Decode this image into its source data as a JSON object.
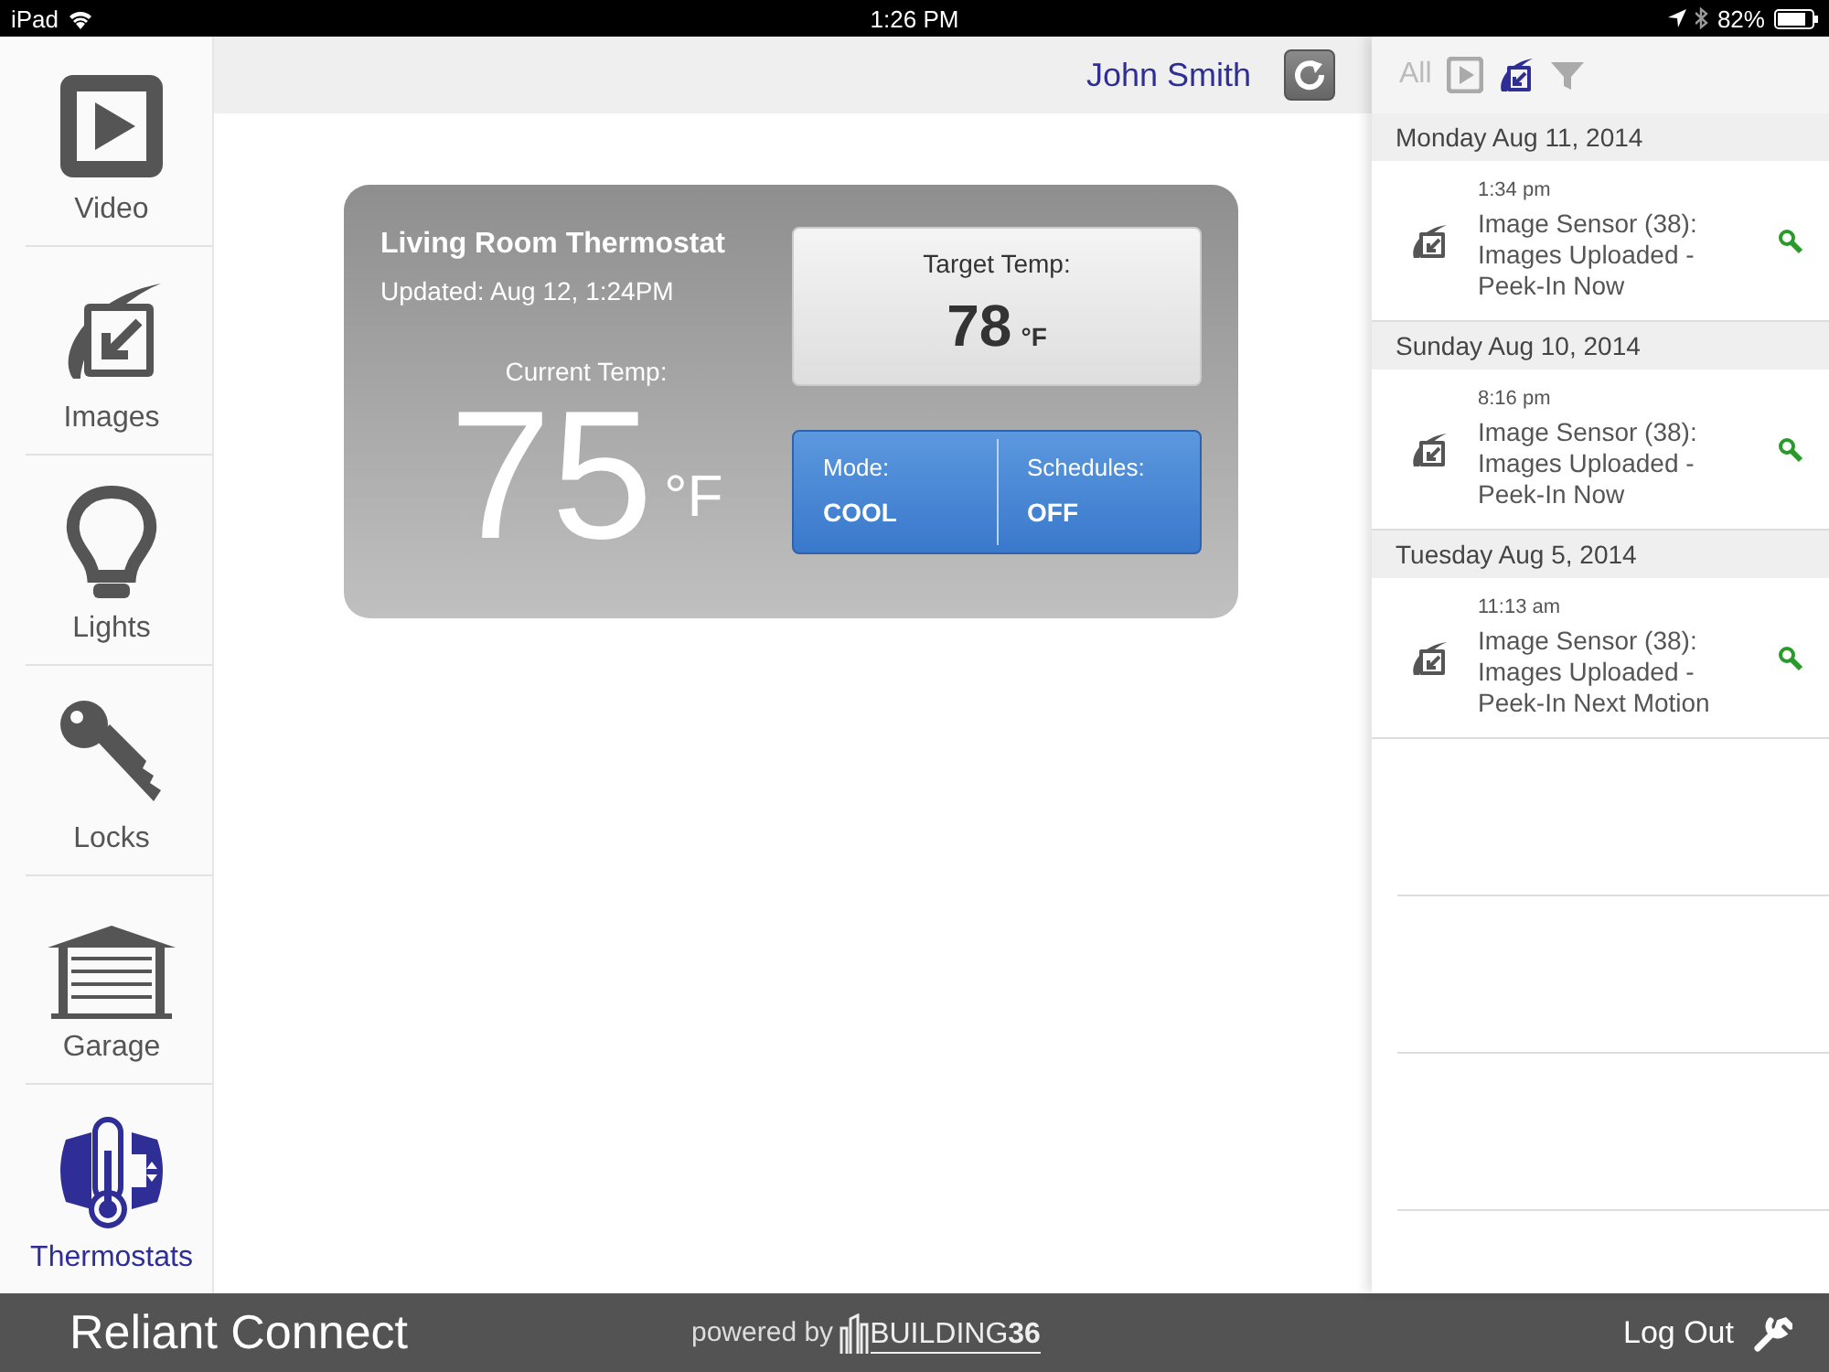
{
  "status_bar": {
    "device": "iPad",
    "time": "1:26 PM",
    "battery": "82%"
  },
  "sidebar": {
    "items": [
      {
        "kind": "video",
        "label": "Video",
        "selected": false
      },
      {
        "kind": "images",
        "label": "Images",
        "selected": false
      },
      {
        "kind": "lights",
        "label": "Lights",
        "selected": false
      },
      {
        "kind": "locks",
        "label": "Locks",
        "selected": false
      },
      {
        "kind": "garage",
        "label": "Garage",
        "selected": false
      },
      {
        "kind": "thermostats",
        "label": "Thermostats",
        "selected": true
      }
    ]
  },
  "header": {
    "user": "John Smith"
  },
  "thermostat": {
    "name": "Living Room Thermostat",
    "updated": "Updated: Aug 12, 1:24PM",
    "current_label": "Current Temp:",
    "current": "75",
    "current_unit": "°F",
    "target_label": "Target Temp:",
    "target": "78",
    "target_unit": "°F",
    "mode_label": "Mode:",
    "mode": "COOL",
    "schedules_label": "Schedules:",
    "schedules": "OFF"
  },
  "events": {
    "filters": [
      {
        "kind": "all",
        "label": "All",
        "selected": false
      },
      {
        "kind": "video",
        "selected": false
      },
      {
        "kind": "images",
        "selected": true
      },
      {
        "kind": "funnel",
        "selected": false
      }
    ],
    "days": [
      {
        "date": "Monday Aug 11, 2014",
        "items": [
          {
            "time": "1:34 pm",
            "text": "Image Sensor (38): Images Uploaded - Peek-In Now"
          }
        ]
      },
      {
        "date": "Sunday Aug 10, 2014",
        "items": [
          {
            "time": "8:16 pm",
            "text": "Image Sensor (38): Images Uploaded - Peek-In Now"
          }
        ]
      },
      {
        "date": "Tuesday Aug 5, 2014",
        "items": [
          {
            "time": "11:13 am",
            "text": "Image Sensor (38): Images Uploaded - Peek-In Next Motion"
          }
        ]
      }
    ]
  },
  "footer": {
    "brand": "Reliant Connect",
    "powered_by": "powered by",
    "logo": "BUILDING**36**",
    "logout": "Log Out"
  }
}
